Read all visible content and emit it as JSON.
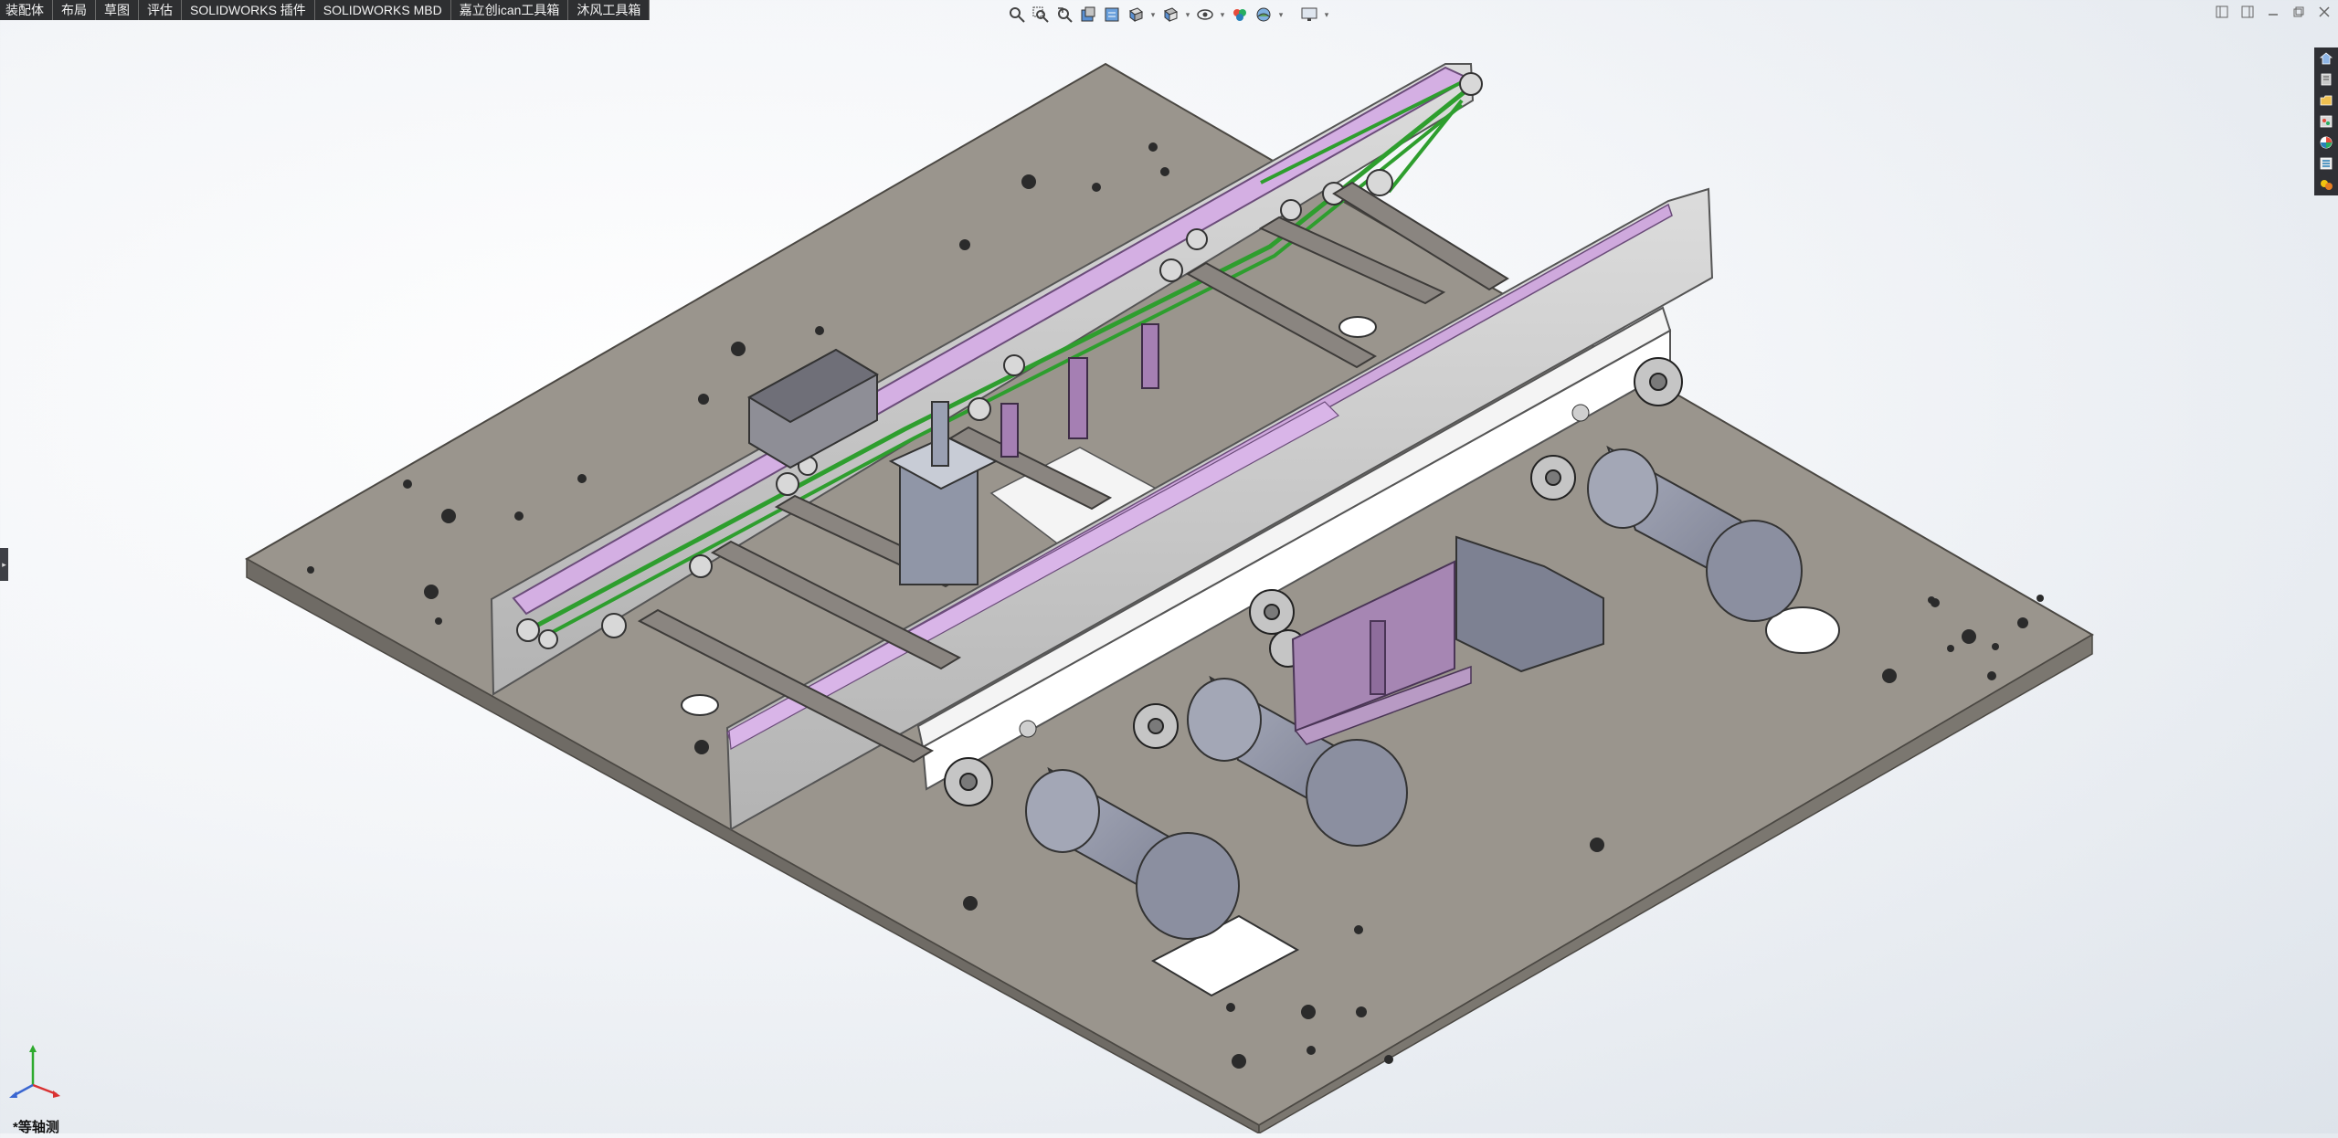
{
  "tabs": [
    {
      "label": "装配体"
    },
    {
      "label": "布局"
    },
    {
      "label": "草图"
    },
    {
      "label": "评估"
    },
    {
      "label": "SOLIDWORKS 插件"
    },
    {
      "label": "SOLIDWORKS MBD"
    },
    {
      "label": "嘉立创ican工具箱"
    },
    {
      "label": "沐风工具箱"
    }
  ],
  "hud_icons": [
    "zoom-to-fit-icon",
    "zoom-area-icon",
    "previous-view-icon",
    "section-view-icon",
    "dynamic-annotation-icon",
    "view-orientation-icon",
    "display-style-icon",
    "hide-show-items-icon",
    "edit-appearance-icon",
    "apply-scene-icon",
    "view-settings-icon"
  ],
  "view": {
    "orientation_label": "*等轴测"
  },
  "colors": {
    "plate": "#9a958d",
    "frame": "#c8c8c8",
    "belt_rail": "#c9a8d8",
    "belt": "#3aa83a",
    "motor": "#8d91a3",
    "mount_plate": "#a686b3",
    "tab_bar": "#2e2f31"
  }
}
